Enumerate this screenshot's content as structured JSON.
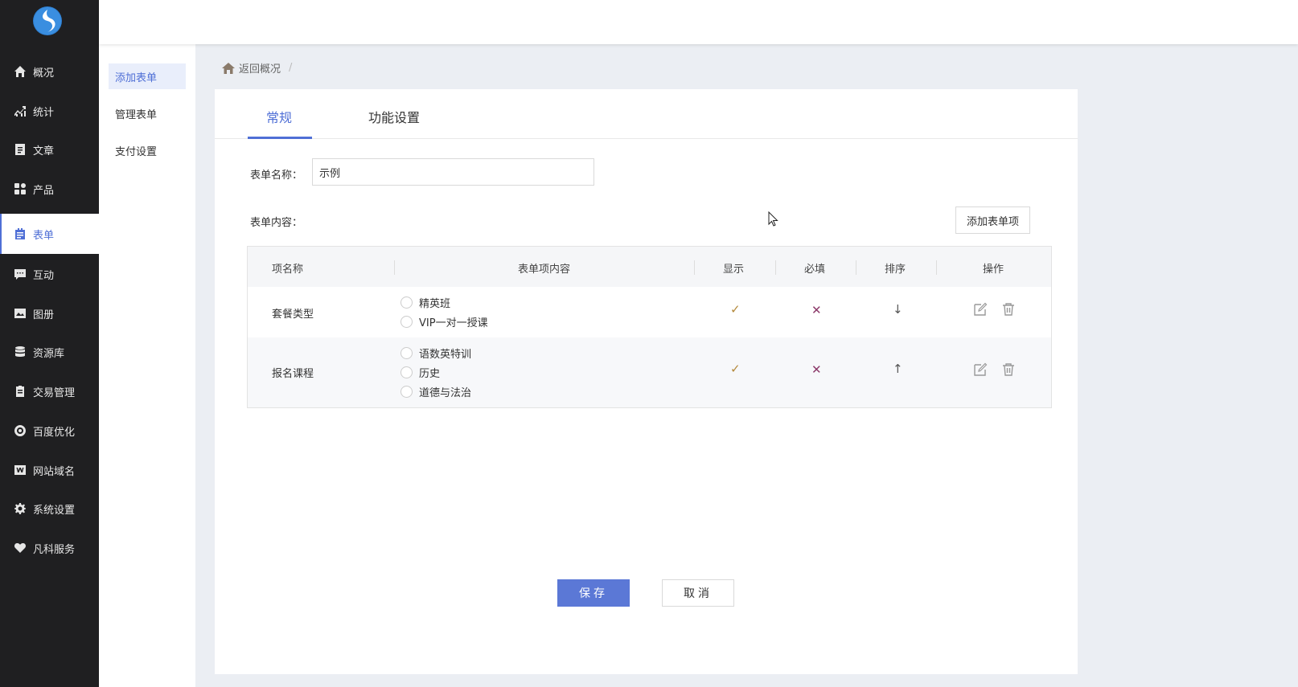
{
  "sidebar": {
    "items": [
      {
        "label": "概况",
        "icon": "home-icon"
      },
      {
        "label": "统计",
        "icon": "stats-icon"
      },
      {
        "label": "文章",
        "icon": "article-icon"
      },
      {
        "label": "产品",
        "icon": "product-icon"
      },
      {
        "label": "表单",
        "icon": "form-icon"
      },
      {
        "label": "互动",
        "icon": "chat-icon"
      },
      {
        "label": "图册",
        "icon": "album-icon"
      },
      {
        "label": "资源库",
        "icon": "database-icon"
      },
      {
        "label": "交易管理",
        "icon": "trade-icon"
      },
      {
        "label": "百度优化",
        "icon": "seo-icon"
      },
      {
        "label": "网站域名",
        "icon": "domain-icon"
      },
      {
        "label": "系统设置",
        "icon": "gear-icon"
      },
      {
        "label": "凡科服务",
        "icon": "heart-icon"
      }
    ],
    "active_label": "表单"
  },
  "subnav": {
    "items": [
      "添加表单",
      "管理表单",
      "支付设置"
    ],
    "active": "添加表单"
  },
  "breadcrumb": {
    "back": "返回概况",
    "separator": "/"
  },
  "tabs": [
    "常规",
    "功能设置"
  ],
  "form": {
    "name_label": "表单名称：",
    "name_value": "示例",
    "content_label": "表单内容：",
    "add_item_button": "添加表单项"
  },
  "table": {
    "headers": [
      "项名称",
      "表单项内容",
      "显示",
      "必填",
      "排序",
      "操作"
    ],
    "rows": [
      {
        "name": "套餐类型",
        "options": [
          "精英班",
          "VIP一对一授课"
        ],
        "show": "✓",
        "required": "✕",
        "sort": "↓"
      },
      {
        "name": "报名课程",
        "options": [
          "语数英特训",
          "历史",
          "道德与法治"
        ],
        "show": "✓",
        "required": "✕",
        "sort": "↑"
      }
    ]
  },
  "actions": {
    "save": "保存",
    "cancel": "取消"
  },
  "colors": {
    "accent": "#4f6fd6",
    "sidebar_bg": "#1f1f21",
    "content_bg": "#ebeef3"
  }
}
